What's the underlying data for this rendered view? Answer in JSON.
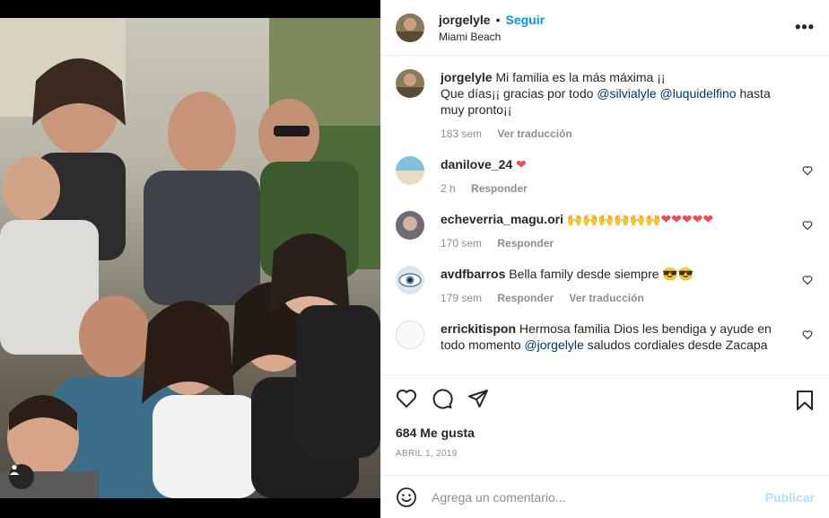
{
  "post": {
    "username": "jorgelyle",
    "separator": "•",
    "follow_label": "Seguir",
    "location": "Miami Beach",
    "more_label": "•••"
  },
  "caption": {
    "username": "jorgelyle",
    "text_1": "Mi familia es la más máxima ¡¡",
    "text_2": "Que días¡¡ gracias por todo",
    "mention_1": "@silvialyle",
    "mention_2": "@luquidelfino",
    "text_3": "hasta muy pronto¡¡",
    "time": "183 sem",
    "translate": "Ver traducción"
  },
  "comments": [
    {
      "username": "danilove_24",
      "text": "❤",
      "time": "2 h",
      "reply": "Responder",
      "translate": ""
    },
    {
      "username": "echeverria_magu.ori",
      "text": "🙌🙌🙌🙌🙌🙌❤❤❤❤❤",
      "time": "170 sem",
      "reply": "Responder",
      "translate": ""
    },
    {
      "username": "avdfbarros",
      "text": "Bella family desde siempre 😎😎",
      "time": "179 sem",
      "reply": "Responder",
      "translate": "Ver traducción"
    },
    {
      "username": "errickitispon",
      "text_1": "Hermosa familia Dios les bendiga y ayude en todo momento",
      "mention": "@jorgelyle",
      "text_2": "saludos cordiales desde Zacapa"
    }
  ],
  "likes": "684 Me gusta",
  "date": "ABRIL 1, 2019",
  "add_comment": {
    "placeholder": "Agrega un comentario...",
    "publish_label": "Publicar"
  },
  "colors": {
    "accent": "#0095f6",
    "publish_disabled": "#b2dffc",
    "muted": "#8e8e8e",
    "heart": "#ed4956"
  },
  "icons": [
    "tag-user-icon",
    "more-icon",
    "heart-icon",
    "comment-icon",
    "share-icon",
    "bookmark-icon",
    "emoji-icon"
  ]
}
